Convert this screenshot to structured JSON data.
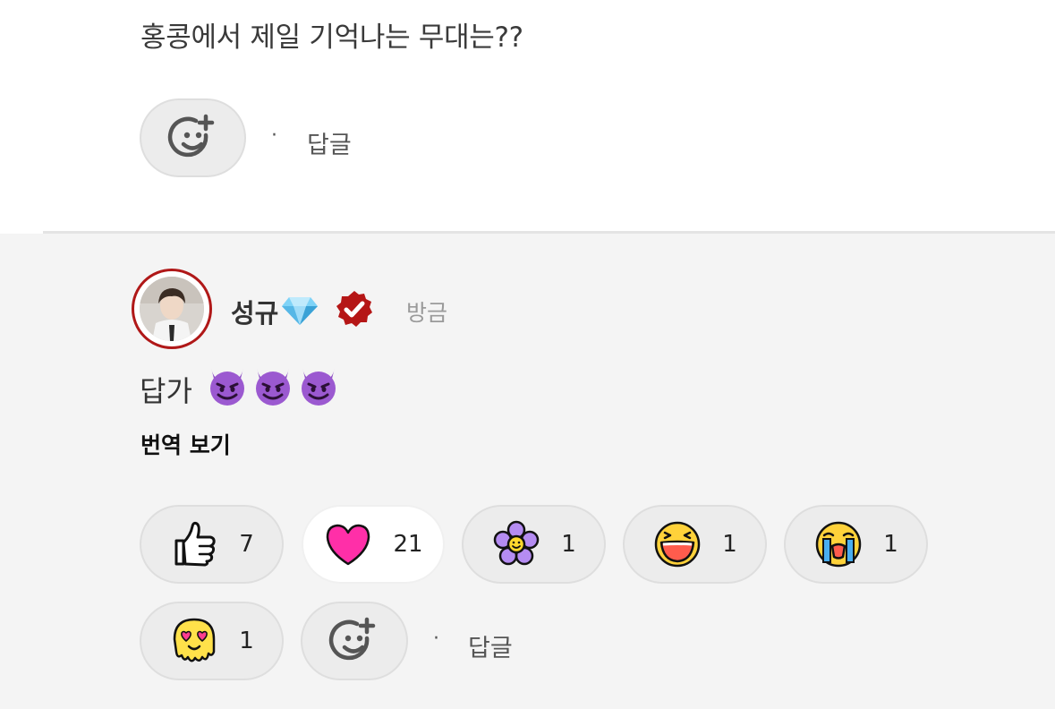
{
  "top_comment": {
    "text": "홍콩에서 제일 기억나는 무대는??",
    "reply_label": "답글",
    "separator": "·"
  },
  "reply": {
    "username": "성규",
    "time": "방금",
    "text": "답가",
    "translate_label": "번역 보기",
    "reply_label": "답글",
    "separator": "·",
    "accent_color": "#b01818",
    "reactions": [
      {
        "icon": "thumbs-up-icon",
        "count": "7"
      },
      {
        "icon": "heart-icon",
        "count": "21",
        "selected": true
      },
      {
        "icon": "flower-icon",
        "count": "1"
      },
      {
        "icon": "laughing-face-icon",
        "count": "1"
      },
      {
        "icon": "crying-face-icon",
        "count": "1"
      },
      {
        "icon": "melting-heart-eyes-icon",
        "count": "1"
      }
    ]
  }
}
